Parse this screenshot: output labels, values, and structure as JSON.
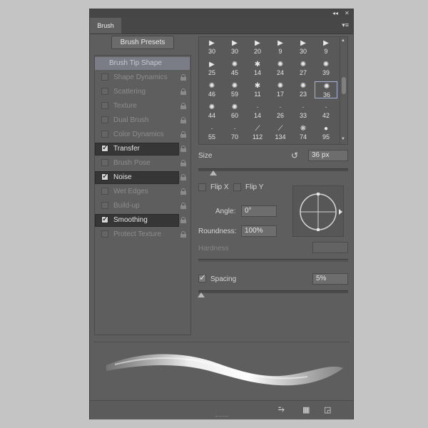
{
  "panel": {
    "tab_label": "Brush",
    "top_controls": {
      "collapse": "◂◂",
      "close": "✕"
    },
    "menu_icon": "▾≡",
    "presets_button": "Brush Presets"
  },
  "left_list": {
    "header": "Brush Tip Shape",
    "items": [
      {
        "label": "Shape Dynamics",
        "checked": false
      },
      {
        "label": "Scattering",
        "checked": false
      },
      {
        "label": "Texture",
        "checked": false
      },
      {
        "label": "Dual Brush",
        "checked": false
      },
      {
        "label": "Color Dynamics",
        "checked": false
      },
      {
        "label": "Transfer",
        "checked": true
      },
      {
        "label": "Brush Pose",
        "checked": false
      },
      {
        "label": "Noise",
        "checked": true
      },
      {
        "label": "Wet Edges",
        "checked": false
      },
      {
        "label": "Build-up",
        "checked": false
      },
      {
        "label": "Smoothing",
        "checked": true
      },
      {
        "label": "Protect Texture",
        "checked": false
      }
    ]
  },
  "brush_grid": {
    "rows": [
      [
        {
          "icon": "▶",
          "n": "30"
        },
        {
          "icon": "▶",
          "n": "30"
        },
        {
          "icon": "▶",
          "n": "20"
        },
        {
          "icon": "▶",
          "n": "9"
        },
        {
          "icon": "▶",
          "n": "30"
        },
        {
          "icon": "▶",
          "n": "9"
        }
      ],
      [
        {
          "icon": "▶",
          "n": "25"
        },
        {
          "icon": "✺",
          "n": "45"
        },
        {
          "icon": "✱",
          "n": "14"
        },
        {
          "icon": "✺",
          "n": "24"
        },
        {
          "icon": "✺",
          "n": "27"
        },
        {
          "icon": "✺",
          "n": "39"
        }
      ],
      [
        {
          "icon": "✺",
          "n": "46"
        },
        {
          "icon": "✺",
          "n": "59"
        },
        {
          "icon": "✱",
          "n": "11"
        },
        {
          "icon": "✺",
          "n": "17"
        },
        {
          "icon": "✺",
          "n": "23"
        },
        {
          "icon": "✺",
          "n": "36",
          "selected": true
        }
      ],
      [
        {
          "icon": "✺",
          "n": "44"
        },
        {
          "icon": "✺",
          "n": "60"
        },
        {
          "icon": "·",
          "n": "14"
        },
        {
          "icon": "·",
          "n": "26"
        },
        {
          "icon": "·",
          "n": "33"
        },
        {
          "icon": "·",
          "n": "42"
        }
      ],
      [
        {
          "icon": "·",
          "n": "55"
        },
        {
          "icon": "·",
          "n": "70"
        },
        {
          "icon": "⟋",
          "n": "112"
        },
        {
          "icon": "⟋",
          "n": "134"
        },
        {
          "icon": "❋",
          "n": "74"
        },
        {
          "icon": "●",
          "n": "95"
        }
      ]
    ]
  },
  "controls": {
    "size_label": "Size",
    "size_value": "36 px",
    "size_level": 0.1,
    "flip_x": "Flip X",
    "flip_y": "Flip Y",
    "angle_label": "Angle:",
    "angle_value": "0°",
    "roundness_label": "Roundness:",
    "roundness_value": "100%",
    "hardness_label": "Hardness",
    "spacing_label": "Spacing",
    "spacing_value": "5%",
    "spacing_checked": true,
    "spacing_level": 0.01
  },
  "bottom_icons": [
    "brush-toggle-icon",
    "grid-icon",
    "new-preset-icon"
  ]
}
